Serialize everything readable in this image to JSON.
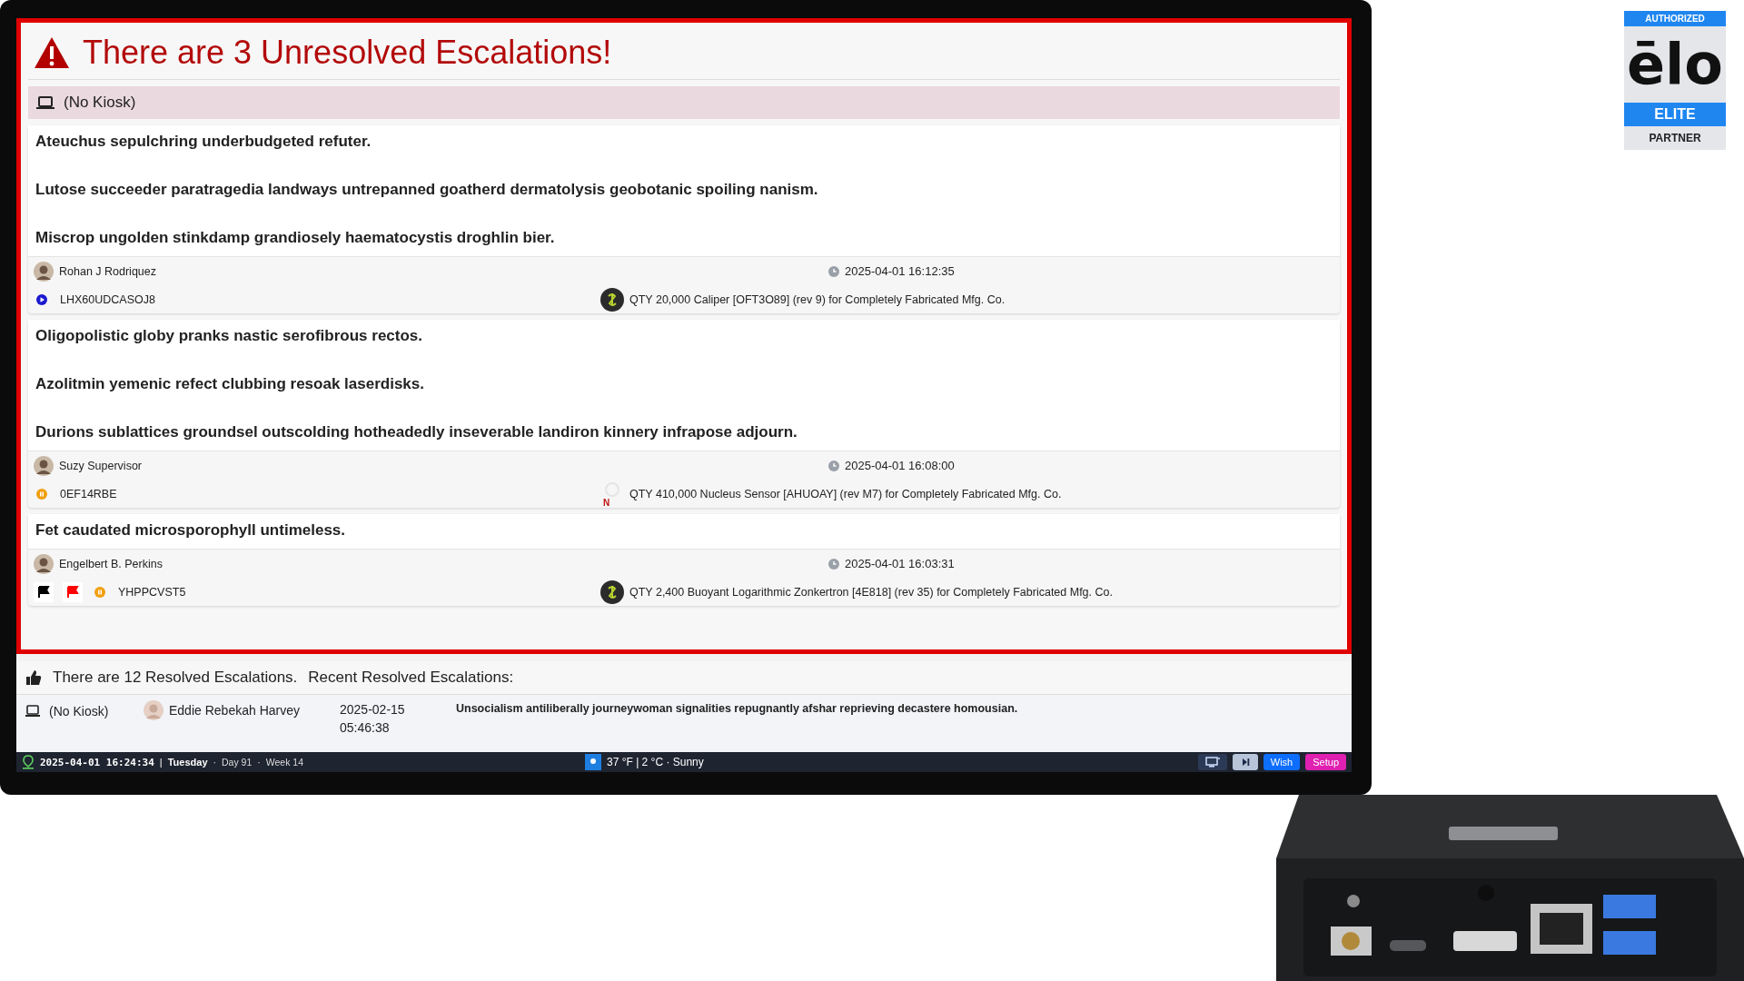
{
  "alert": {
    "title": "There are 3 Unresolved Escalations!"
  },
  "kiosk": {
    "label": "(No Kiosk)"
  },
  "escalations": [
    {
      "lines": [
        "Ateuchus sepulchring underbudgeted refuter.",
        "Lutose succeeder paratragedia landways untrepanned goatherd dermatolysis geobotanic spoiling nanism.",
        "Miscrop ungolden stinkdamp grandiosely haematocystis droghlin bier."
      ],
      "user": "Rohan J Rodriquez",
      "time": "2025-04-01 16:12:35",
      "status": {
        "kind": "play"
      },
      "code": "LHX60UDCASOJ8",
      "part_icon": {
        "kind": "logo"
      },
      "part": "QTY 20,000 Caliper [OFT3O89] (rev 9) for Completely Fabricated Mfg. Co."
    },
    {
      "lines": [
        "Oligopolistic globy pranks nastic serofibrous rectos.",
        "Azolitmin yemenic refect clubbing resoak laserdisks.",
        "Durions sublattices groundsel outscolding hotheadedly inseverable landiron kinnery infrapose adjourn."
      ],
      "user": "Suzy Supervisor",
      "time": "2025-04-01 16:08:00",
      "status": {
        "kind": "pause"
      },
      "code": "0EF14RBE",
      "part_icon": {
        "kind": "new",
        "text": "N"
      },
      "part": "QTY 410,000 Nucleus Sensor [AHUOAY] (rev M7) for Completely Fabricated Mfg. Co."
    },
    {
      "lines": [
        "Fet caudated microsporophyll untimeless."
      ],
      "user": "Engelbert B. Perkins",
      "time": "2025-04-01 16:03:31",
      "flags": [
        {
          "color": "#000000"
        },
        {
          "color": "#ff0000"
        }
      ],
      "status": {
        "kind": "pause"
      },
      "code": "YHPPCVST5",
      "part_icon": {
        "kind": "logo"
      },
      "part": "QTY 2,400 Buoyant Logarithmic Zonkertron [4E818] (rev 35) for Completely Fabricated Mfg. Co."
    }
  ],
  "resolved": {
    "summary": "There are 12 Resolved Escalations.",
    "recent_label": "Recent Resolved Escalations:",
    "rows": [
      {
        "kiosk": "(No Kiosk)",
        "user": "Eddie Rebekah Harvey",
        "date": "2025-02-15",
        "time": "05:46:38",
        "text": "Unsocialism antiliberally journeywoman signalities repugnantly afshar reprieving decastere homousian."
      }
    ]
  },
  "status_bar": {
    "datetime": "2025-04-01 16:24:34",
    "sep": "|",
    "weekday": "Tuesday",
    "dot1": "·",
    "day": "Day 91",
    "dot2": "·",
    "week": "Week 14",
    "weather": "37 °F | 2 °C · Sunny",
    "buttons": [
      {
        "kind": "icon"
      },
      {
        "kind": "media"
      },
      {
        "kind": "text",
        "label": "Wish",
        "color": "#0d6efd"
      },
      {
        "kind": "text",
        "label": "Setup",
        "color": "#e020b0"
      }
    ]
  },
  "badge": {
    "top": "AUTHORIZED",
    "logo": "ēlo",
    "middle": "ELITE",
    "bottom": "PARTNER"
  }
}
